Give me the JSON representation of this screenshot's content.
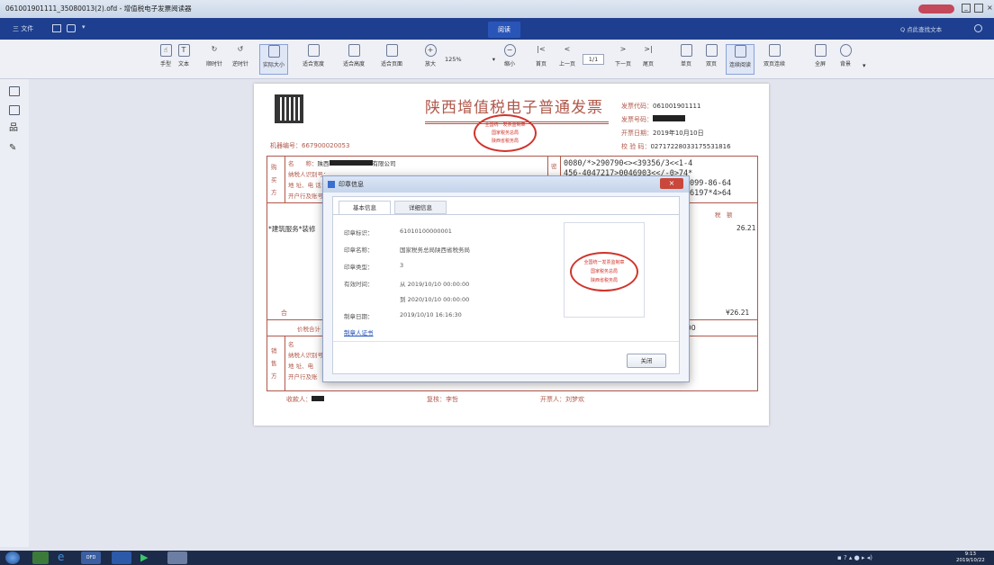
{
  "window": {
    "title": "061001901111_35080013(2).ofd - 增值税电子发票阅读器"
  },
  "menubar": {
    "file_label": "三 文件",
    "center_tab": "阅读",
    "search_label": "Q 点此查找文本"
  },
  "toolbar": {
    "buttons": [
      {
        "label": "手型",
        "icon": "hand-icon"
      },
      {
        "label": "文本",
        "icon": "text-select-icon"
      },
      {
        "label": "顺时针",
        "icon": "rotate-cw-icon"
      },
      {
        "label": "逆时针",
        "icon": "rotate-ccw-icon"
      },
      {
        "label": "实际大小",
        "icon": "actual-size-icon"
      },
      {
        "label": "适合宽度",
        "icon": "fit-width-icon"
      },
      {
        "label": "适合高度",
        "icon": "fit-height-icon"
      },
      {
        "label": "适合页面",
        "icon": "fit-page-icon"
      },
      {
        "label": "放大",
        "icon": "zoom-in-icon"
      },
      {
        "label": "缩小",
        "icon": "zoom-out-icon"
      },
      {
        "label": "首页",
        "icon": "first-page-icon"
      },
      {
        "label": "上一页",
        "icon": "prev-page-icon"
      },
      {
        "label": "下一页",
        "icon": "next-page-icon"
      },
      {
        "label": "尾页",
        "icon": "last-page-icon"
      },
      {
        "label": "单页",
        "icon": "single-page-icon"
      },
      {
        "label": "双页",
        "icon": "double-page-icon"
      },
      {
        "label": "连续阅读",
        "icon": "continuous-icon"
      },
      {
        "label": "双页连续",
        "icon": "double-continuous-icon"
      },
      {
        "label": "全屏",
        "icon": "fullscreen-icon"
      },
      {
        "label": "背景",
        "icon": "background-icon"
      }
    ],
    "zoom": "125%",
    "page": "1/1"
  },
  "invoice": {
    "title": "陕西增值税电子普通发票",
    "machine_no": "机器编号：667900020053",
    "code_label": "发票代码：",
    "code": "061001901111",
    "number_label": "发票号码：",
    "date_label": "开票日期：",
    "date": "2019年10月10日",
    "check_label": "校 验 码：",
    "check": "02717228033175531816",
    "buyer_name_label": "名　　称：",
    "buyer_name_a": "陕西",
    "buyer_name_b": "有限公司",
    "buyer_side": "购买方",
    "buyer_taxid_label": "纳税人识别号：",
    "buyer_addr_label": "地 址、电 话：",
    "buyer_bank_label": "开户行及账号：",
    "cipher": [
      "0080/*>290790<><39356/3<<1-4",
      "456-4047217>0046903<</-0>74*",
      "099-86-64",
      "6197*4>64"
    ],
    "cipher_label": "密",
    "item_header": "税　额",
    "item_name": "*建筑服务*装修",
    "tax": "26.21",
    "total_label": "合",
    "total": "¥26.21",
    "total_with_tax_label": "价税合计",
    "total_with_tax": ".00",
    "seller_side": "销售方",
    "seller_name_label": "名",
    "seller_taxid_label": "纳税人识别号",
    "seller_addr_label": "地 址、电",
    "seller_bank_label": "开户行及账",
    "payee_label": "收款人：",
    "reviewer": "复核：李哲",
    "drawer": "开票人：刘梦欢",
    "seal_top": "全国统一发票监制章",
    "seal_mid": "国家税务总局",
    "seal_bot": "陕西省税务局"
  },
  "dialog": {
    "title": "印章信息",
    "tabs": [
      "基本信息",
      "详细信息"
    ],
    "fields": [
      {
        "label": "印章标识：",
        "value": "61010100000001"
      },
      {
        "label": "印章名称：",
        "value": "国家税务总局陕西省税务局"
      },
      {
        "label": "印章类型：",
        "value": "3"
      },
      {
        "label": "有效时间：",
        "value": "从  2019/10/10 00:00:00"
      },
      {
        "label": "",
        "value": "到  2020/10/10 00:00:00"
      },
      {
        "label": "制章日期：",
        "value": "2019/10/10 16:16:30"
      }
    ],
    "link": "制章人证书",
    "close": "关闭",
    "seal_top": "全国统一发票监制章",
    "seal_mid": "国家税务总局",
    "seal_bot": "陕西省税务局"
  },
  "taskbar": {
    "ofd_label": "OFD",
    "clock_time": "9:13",
    "clock_date": "2019/10/22"
  },
  "colors": {
    "menubar": "#1e3f8f",
    "seal_red": "#d0352c",
    "invoice_brown": "#b0584b"
  }
}
